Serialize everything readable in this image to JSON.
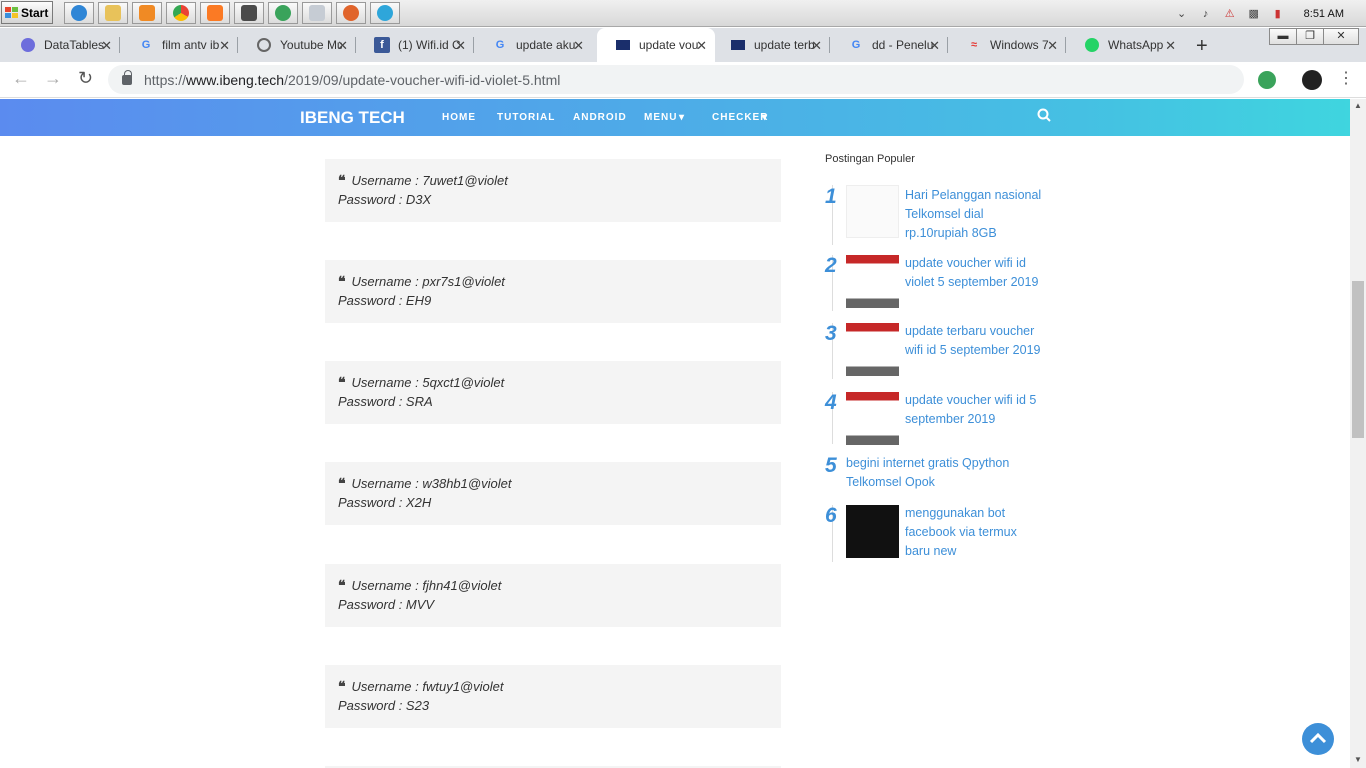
{
  "taskbar": {
    "start_label": "Start",
    "clock": "8:51 AM",
    "apps": [
      "internet-explorer-icon",
      "file-explorer-icon",
      "media-player-icon",
      "chrome-icon",
      "xampp-icon",
      "sublime-text-icon",
      "network-globe-icon",
      "window-icon",
      "firefox-icon",
      "telegram-icon"
    ]
  },
  "tabs": [
    {
      "title": "DataTables",
      "icon": "datatables-icon"
    },
    {
      "title": "film antv ib",
      "icon": "google-icon"
    },
    {
      "title": "Youtube Mu",
      "icon": "globe-icon"
    },
    {
      "title": "(1) Wifi.id C",
      "icon": "facebook-icon"
    },
    {
      "title": "update aku",
      "icon": "google-icon"
    },
    {
      "title": "update vou",
      "icon": "monitor-icon",
      "active": true
    },
    {
      "title": "update terb",
      "icon": "monitor-icon"
    },
    {
      "title": "dd - Penelu",
      "icon": "google-icon"
    },
    {
      "title": "Windows 7",
      "icon": "wifi-icon"
    },
    {
      "title": "WhatsApp",
      "icon": "whatsapp-icon"
    }
  ],
  "url": {
    "prefix": "https://",
    "host": "www.ibeng.tech",
    "path": "/2019/09/update-voucher-wifi-id-violet-5.html"
  },
  "site": {
    "brand": "IBENG TECH",
    "menu": [
      "HOME",
      "TUTORIAL",
      "ANDROID",
      "MENU",
      "CHECKER"
    ]
  },
  "vouchers": [
    {
      "username": "Username : 7uwet1@violet",
      "password": "Password : D3X"
    },
    {
      "username": "Username : pxr7s1@violet",
      "password": "Password : EH9"
    },
    {
      "username": "Username : 5qxct1@violet",
      "password": "Password : SRA"
    },
    {
      "username": "Username : w38hb1@violet",
      "password": "Password : X2H"
    },
    {
      "username": "Username : fjhn41@violet",
      "password": "Password : MVV"
    },
    {
      "username": "Username : fwtuy1@violet",
      "password": "Password : S23"
    }
  ],
  "sidebar": {
    "title": "Postingan Populer",
    "posts": [
      {
        "num": "1",
        "title": "Hari Pelanggan nasional Telkomsel dial rp.10rupiah 8GB"
      },
      {
        "num": "2",
        "title": "update voucher wifi id violet 5 september 2019"
      },
      {
        "num": "3",
        "title": "update terbaru voucher wifi id 5 september 2019"
      },
      {
        "num": "4",
        "title": "update voucher wifi id 5 september 2019"
      },
      {
        "num": "5",
        "title": "begini internet gratis Qpython Telkomsel Opok"
      },
      {
        "num": "6",
        "title": "menggunakan bot facebook via termux baru new"
      }
    ]
  },
  "colors": {
    "accent": "#3d8fd8",
    "header_start": "#5b8bef",
    "header_end": "#3fd5df"
  }
}
